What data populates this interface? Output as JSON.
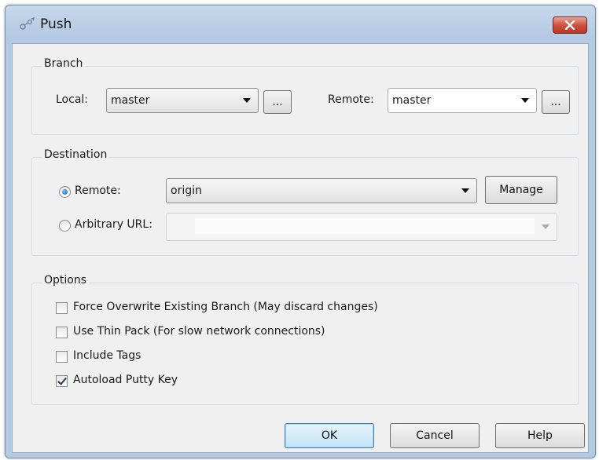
{
  "window": {
    "title": "Push"
  },
  "branch": {
    "group_title": "Branch",
    "local_label": "Local:",
    "local_value": "master",
    "remote_label": "Remote:",
    "remote_value": "master",
    "browse_label": "..."
  },
  "destination": {
    "group_title": "Destination",
    "remote_radio_label": "Remote:",
    "remote_value": "origin",
    "manage_label": "Manage",
    "url_radio_label": "Arbitrary URL:",
    "url_value": "",
    "selected": "remote"
  },
  "options": {
    "group_title": "Options",
    "items": [
      {
        "label": "Force Overwrite Existing Branch (May discard changes)",
        "checked": false
      },
      {
        "label": "Use Thin Pack (For slow network connections)",
        "checked": false
      },
      {
        "label": "Include Tags",
        "checked": false
      },
      {
        "label": "Autoload Putty Key",
        "checked": true
      }
    ]
  },
  "buttons": {
    "ok": "OK",
    "cancel": "Cancel",
    "help": "Help"
  }
}
